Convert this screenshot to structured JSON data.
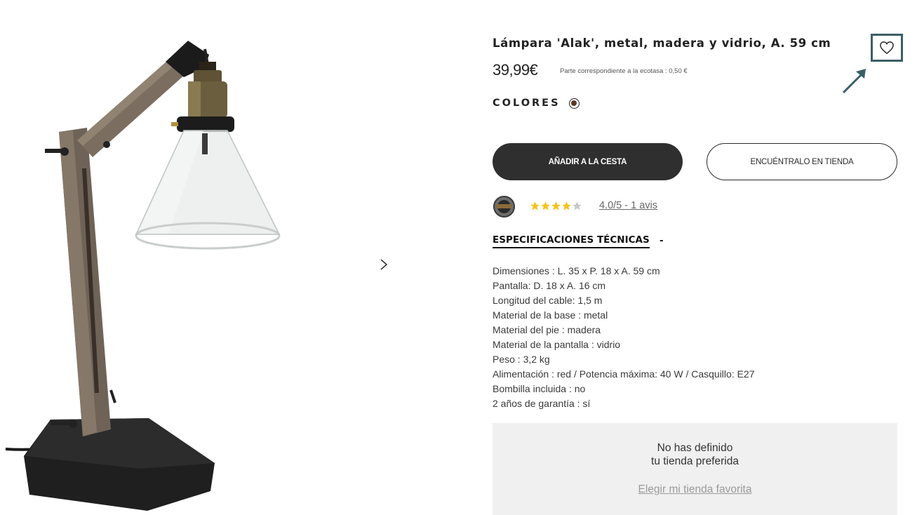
{
  "product": {
    "title": "Lámpara 'Alak', metal, madera y vidrio, A. 59 cm",
    "price": "39,99€",
    "ecotax": "Parte correspondiente a la ecotasa : 0,50 €",
    "image_alt": "lamp-product-photo"
  },
  "colors": {
    "label": "COLORES",
    "selected_swatch": "#5a3a22"
  },
  "actions": {
    "add_to_cart": "AÑADIR A LA CESTA",
    "find_in_store": "ENCUÉNTRALO EN TIENDA"
  },
  "favorite": {
    "icon": "heart-outline-icon",
    "highlight_color": "#3c5f66"
  },
  "reviews": {
    "badge_icon": "verified-reviews-badge-icon",
    "stars_filled": 4,
    "stars_total": 5,
    "star_color": "#f4c21a",
    "link_text": "4.0/5 - 1 avis"
  },
  "specs": {
    "heading": "ESPECIFICACIONES TÉCNICAS",
    "toggle": "-",
    "items": [
      "Dimensiones : L. 35 x P. 18 x A. 59 cm",
      "Pantalla: D. 18 x A. 16 cm",
      "Longitud del cable: 1,5 m",
      "Material de la base : metal",
      "Material del pie : madera",
      "Material de la pantalla : vidrio",
      "Peso : 3,2 kg",
      "Alimentación : red / Potencia máxima: 40 W / Casquillo: E27",
      "Bombilla incluida : no",
      "2 años de garantía : sí"
    ]
  },
  "store": {
    "message_line1": "No has definido",
    "message_line2": "tu tienda preferida",
    "link_text": "Elegir mi tienda favorita"
  }
}
